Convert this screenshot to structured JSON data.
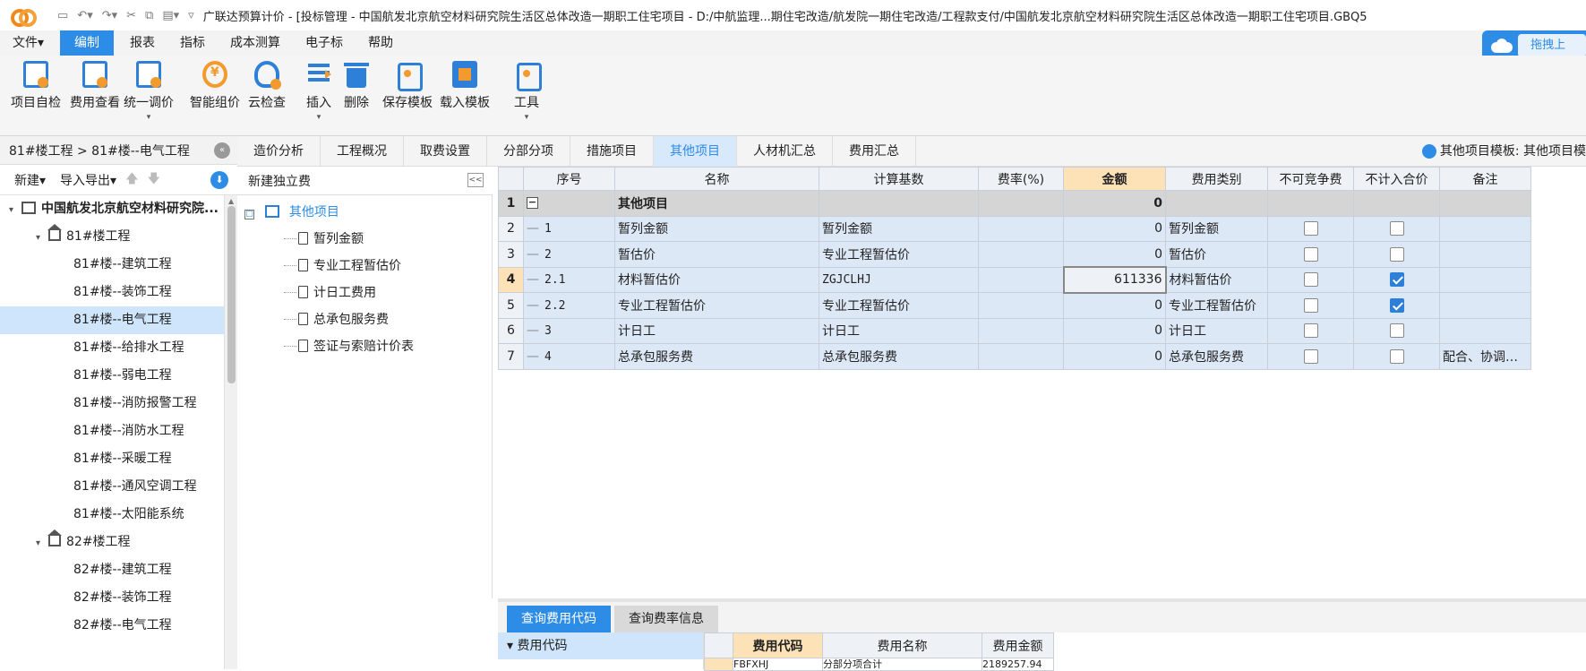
{
  "window": {
    "title": "广联达预算计价 - [投标管理 - 中国航发北京航空材料研究院生活区总体改造一期职工住宅项目 - D:/中航监理...期住宅改造/航发院一期住宅改造/工程款支付/中国航发北京航空材料研究院生活区总体改造一期职工住宅项目.GBQ5"
  },
  "menu": {
    "items": [
      "文件▾",
      "编制",
      "报表",
      "指标",
      "成本测算",
      "电子标",
      "帮助"
    ],
    "active": "编制"
  },
  "upload_button": "拖拽上传",
  "toolbar": {
    "buttons": [
      {
        "label": "项目自检",
        "icon": "project-check-icon"
      },
      {
        "label": "费用查看",
        "icon": "fee-view-icon"
      },
      {
        "label": "统一调价",
        "icon": "unified-price-icon",
        "dropdown": "▾"
      },
      {
        "label": "智能组价",
        "icon": "smart-pricing-icon"
      },
      {
        "label": "云检查",
        "icon": "cloud-check-icon"
      },
      {
        "label": "插入",
        "icon": "insert-icon",
        "dropdown": "▾"
      },
      {
        "label": "删除",
        "icon": "delete-icon"
      },
      {
        "label": "保存模板",
        "icon": "save-template-icon"
      },
      {
        "label": "载入模板",
        "icon": "load-template-icon"
      },
      {
        "label": "工具",
        "icon": "tools-icon",
        "dropdown": "▾"
      }
    ]
  },
  "left_panel": {
    "breadcrumb": "81#楼工程 > 81#楼--电气工程",
    "collapse_icon": "«",
    "new_label": "新建▾",
    "import_export_label": "导入导出▾",
    "up_arrow": "🡅",
    "down_arrow": "🡇",
    "download_icon": "⬇",
    "tree": [
      {
        "label": "中国航发北京航空材料研究院...",
        "level": 0,
        "type": "project",
        "toggle": "▾"
      },
      {
        "label": "81#楼工程",
        "level": 1,
        "type": "building",
        "toggle": "▾"
      },
      {
        "label": "81#楼--建筑工程",
        "level": 2
      },
      {
        "label": "81#楼--装饰工程",
        "level": 2
      },
      {
        "label": "81#楼--电气工程",
        "level": 2,
        "selected": true
      },
      {
        "label": "81#楼--给排水工程",
        "level": 2
      },
      {
        "label": "81#楼--弱电工程",
        "level": 2
      },
      {
        "label": "81#楼--消防报警工程",
        "level": 2
      },
      {
        "label": "81#楼--消防水工程",
        "level": 2
      },
      {
        "label": "81#楼--采暖工程",
        "level": 2
      },
      {
        "label": "81#楼--通风空调工程",
        "level": 2
      },
      {
        "label": "81#楼--太阳能系统",
        "level": 2
      },
      {
        "label": "82#楼工程",
        "level": 1,
        "type": "building",
        "toggle": "▾"
      },
      {
        "label": "82#楼--建筑工程",
        "level": 2
      },
      {
        "label": "82#楼--装饰工程",
        "level": 2
      },
      {
        "label": "82#楼--电气工程",
        "level": 2
      }
    ]
  },
  "tabs": {
    "items": [
      "造价分析",
      "工程概况",
      "取费设置",
      "分部分项",
      "措施项目",
      "其他项目",
      "人材机汇总",
      "费用汇总"
    ],
    "active": "其他项目",
    "template_label": "其他项目模板: 其他项目模"
  },
  "mid_panel": {
    "header": "新建独立费",
    "collapse_icon": "<<",
    "root": "其他项目",
    "root_toggle": "□",
    "items": [
      "暂列金额",
      "专业工程暂估价",
      "计日工费用",
      "总承包服务费",
      "签证与索赔计价表"
    ]
  },
  "grid": {
    "columns": [
      "",
      "序号",
      "名称",
      "计算基数",
      "费率(%)",
      "金额",
      "费用类别",
      "不可竞争费",
      "不计入合价",
      "备注"
    ],
    "rows": [
      {
        "rn": "1",
        "seq": "",
        "name": "其他项目",
        "base": "",
        "rate": "",
        "amount": "0",
        "category": "",
        "noncomp": null,
        "excl": null,
        "note": "",
        "group": true,
        "toggle": "−"
      },
      {
        "rn": "2",
        "seq": "1",
        "name": "暂列金额",
        "base": "暂列金额",
        "rate": "",
        "amount": "0",
        "category": "暂列金额",
        "noncomp": false,
        "excl": false,
        "note": ""
      },
      {
        "rn": "3",
        "seq": "2",
        "name": "暂估价",
        "base": "专业工程暂估价",
        "rate": "",
        "amount": "0",
        "category": "暂估价",
        "noncomp": false,
        "excl": false,
        "note": ""
      },
      {
        "rn": "4",
        "seq": "2.1",
        "name": "材料暂估价",
        "base": "ZGJCLHJ",
        "rate": "",
        "amount": "611336",
        "category": "材料暂估价",
        "noncomp": false,
        "excl": true,
        "note": "",
        "selected": true
      },
      {
        "rn": "5",
        "seq": "2.2",
        "name": "专业工程暂估价",
        "base": "专业工程暂估价",
        "rate": "",
        "amount": "0",
        "category": "专业工程暂估价",
        "noncomp": false,
        "excl": true,
        "note": ""
      },
      {
        "rn": "6",
        "seq": "3",
        "name": "计日工",
        "base": "计日工",
        "rate": "",
        "amount": "0",
        "category": "计日工",
        "noncomp": false,
        "excl": false,
        "note": ""
      },
      {
        "rn": "7",
        "seq": "4",
        "name": "总承包服务费",
        "base": "总承包服务费",
        "rate": "",
        "amount": "0",
        "category": "总承包服务费",
        "noncomp": false,
        "excl": false,
        "note": "配合、协调…"
      }
    ]
  },
  "bottom_panel": {
    "tabs": [
      "查询费用代码",
      "查询费率信息"
    ],
    "active_tab": "查询费用代码",
    "tree_header": "费用代码",
    "tree_toggle": "▾",
    "columns": [
      "",
      "费用代码",
      "费用名称",
      "费用金额"
    ],
    "partial_row": [
      "",
      "FBFXHJ",
      "分部分项合计",
      "2189257.94"
    ]
  }
}
